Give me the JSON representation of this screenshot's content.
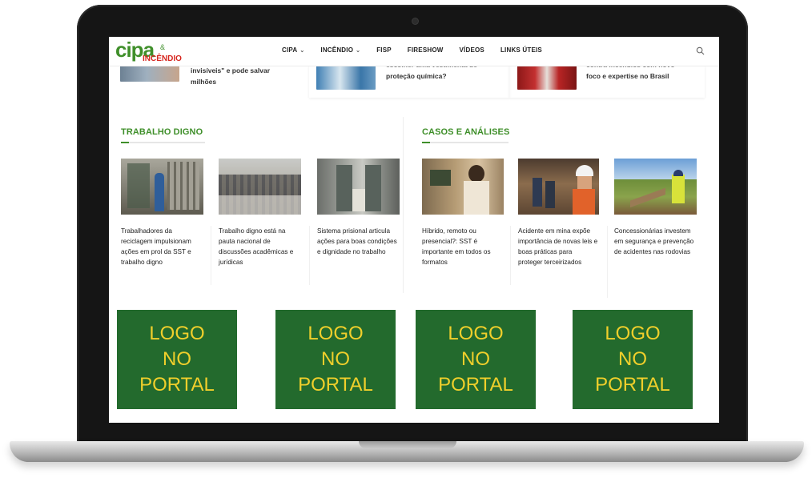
{
  "site": {
    "logo_main": "cipa",
    "logo_amp": "&",
    "logo_sub": "INCÊNDIO"
  },
  "nav": {
    "items": [
      {
        "label": "CIPA",
        "has_dropdown": true
      },
      {
        "label": "INCÊNDIO",
        "has_dropdown": true
      },
      {
        "label": "FISP",
        "has_dropdown": false
      },
      {
        "label": "FIRESHOW",
        "has_dropdown": false
      },
      {
        "label": "VÍDEOS",
        "has_dropdown": false
      },
      {
        "label": "LINKS ÚTEIS",
        "has_dropdown": false
      }
    ],
    "chevron": "⌄",
    "search_icon": "search-icon"
  },
  "top_row": {
    "items": [
      {
        "line1": "invisíveis\" e pode salvar",
        "line2": "milhões"
      },
      {
        "line1": "escolher uma vestimenta de",
        "line2": "proteção química?"
      },
      {
        "line1": "contra incêndios com novo",
        "line2": "foco e expertise no Brasil"
      }
    ]
  },
  "sections": {
    "trabalho": {
      "title": "TRABALHO DIGNO",
      "articles": [
        {
          "title": "Trabalhadores da reciclagem impulsionam ações em prol da SST e trabalho digno"
        },
        {
          "title": "Trabalho digno está na pauta nacional de discussões acadêmicas e jurídicas"
        },
        {
          "title": "Sistema prisional articula ações para boas condições e dignidade no trabalho"
        }
      ]
    },
    "casos": {
      "title": "CASOS E ANÁLISES",
      "articles": [
        {
          "title": "Híbrido, remoto ou presencial?: SST é importante em todos os formatos"
        },
        {
          "title": "Acidente em mina expõe importância de novas leis e boas práticas para proteger terceirizados"
        },
        {
          "title": "Concessionárias investem em segurança e prevenção de acidentes nas rodovias"
        }
      ]
    }
  },
  "ads": {
    "boxes": [
      {
        "l1": "LOGO",
        "l2": "NO",
        "l3": "PORTAL"
      },
      {
        "l1": "LOGO",
        "l2": "NO",
        "l3": "PORTAL"
      },
      {
        "l1": "LOGO",
        "l2": "NO",
        "l3": "PORTAL"
      },
      {
        "l1": "LOGO",
        "l2": "NO",
        "l3": "PORTAL"
      }
    ],
    "bg_color": "#236a2d",
    "text_color": "#f0cf2b"
  },
  "colors": {
    "brand_green": "#3f8f2a",
    "brand_red": "#d7261f"
  }
}
